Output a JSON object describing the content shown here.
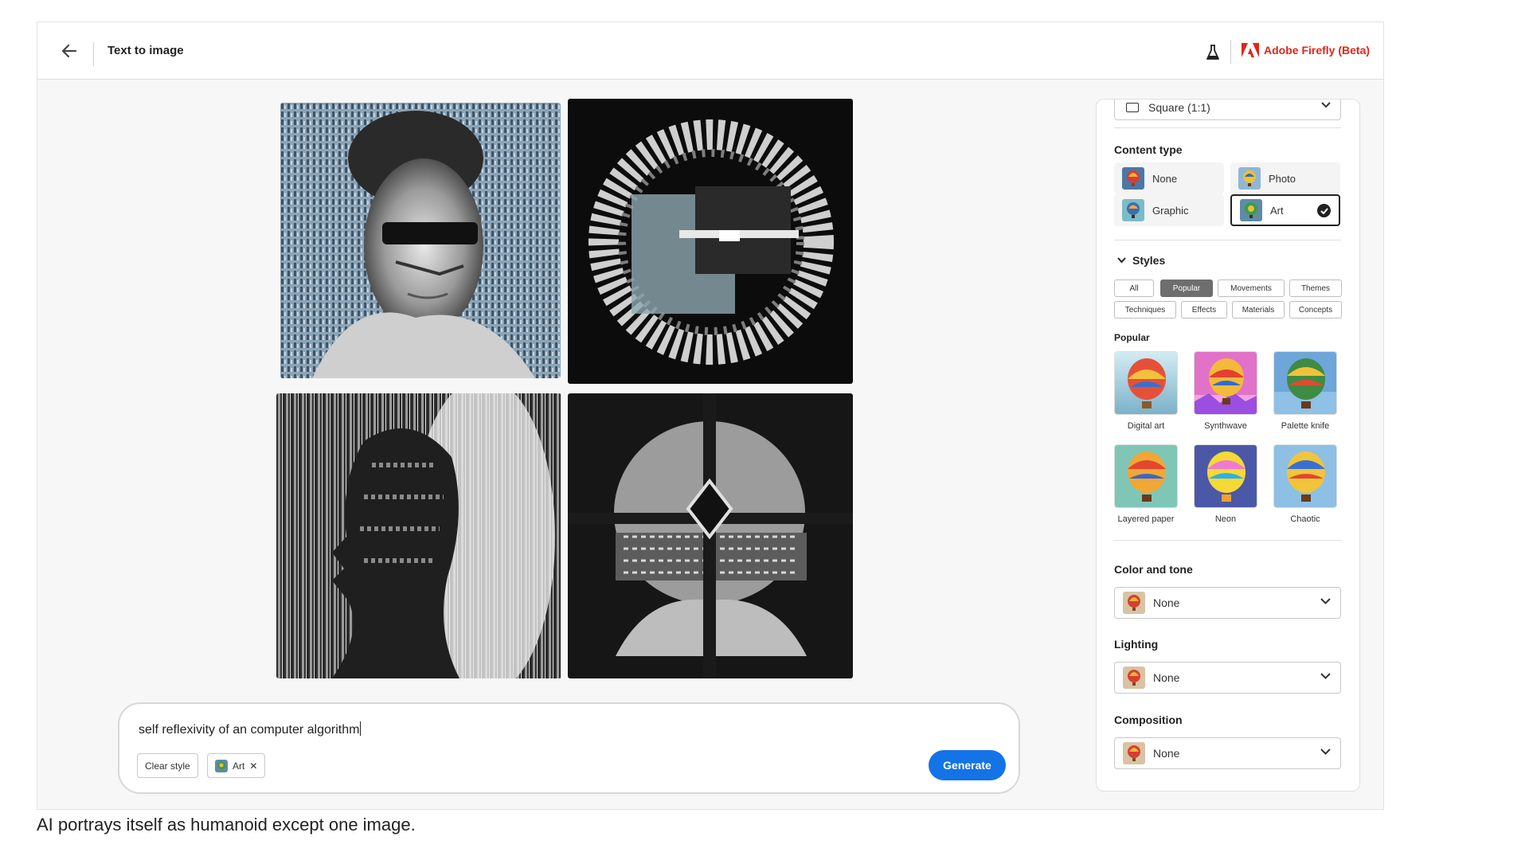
{
  "header": {
    "back_icon": "arrow-left-icon",
    "title": "Text to image",
    "labs_icon": "flask-icon",
    "brand_icon": "adobe-logo-icon",
    "brand": "Adobe Firefly (Beta)",
    "brand_color": "#e1251b"
  },
  "gallery": {
    "images": [
      {
        "name": "humanoid-with-sunglasses",
        "tone": "blue-grey"
      },
      {
        "name": "circular-fragment-ring",
        "tone": "monochrome"
      },
      {
        "name": "profile-head-with-light-streaks",
        "tone": "monochrome"
      },
      {
        "name": "circuit-head-with-diamond",
        "tone": "monochrome"
      }
    ]
  },
  "prompt": {
    "text": "self reflexivity of an computer algorithm",
    "clear_style": "Clear style",
    "style_chip": "Art",
    "remove_icon": "close-icon",
    "generate": "Generate",
    "accent": "#1473e6"
  },
  "panel": {
    "aspect_ratio": "Square (1:1)",
    "content_type": {
      "title": "Content type",
      "options": [
        "None",
        "Photo",
        "Graphic",
        "Art"
      ],
      "selected": "Art"
    },
    "styles": {
      "title": "Styles",
      "tags_row1": [
        "All",
        "Popular",
        "Movements",
        "Themes"
      ],
      "tags_row2": [
        "Techniques",
        "Effects",
        "Materials",
        "Concepts"
      ],
      "active_tag": "Popular",
      "section": "Popular",
      "items": [
        "Digital art",
        "Synthwave",
        "Palette knife",
        "Layered paper",
        "Neon",
        "Chaotic"
      ]
    },
    "color_tone": {
      "title": "Color and tone",
      "value": "None"
    },
    "lighting": {
      "title": "Lighting",
      "value": "None"
    },
    "composition": {
      "title": "Composition",
      "value": "None"
    }
  },
  "caption": "AI portrays itself as humanoid except one image."
}
